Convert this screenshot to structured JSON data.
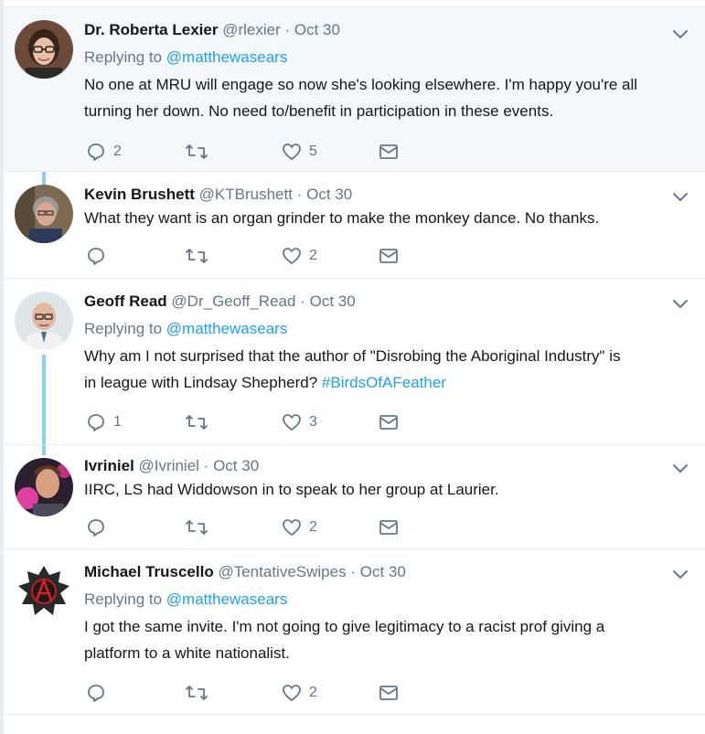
{
  "tweets": [
    {
      "name": "Dr. Roberta Lexier",
      "handle": "@rlexier",
      "separator": "·",
      "time": "Oct 30",
      "replying_prefix": "Replying to",
      "replying_to": "@matthewasears",
      "text_line1": "No one at MRU will engage so now she's looking elsewhere. I'm happy you're all",
      "text_line2": "turning her down. No need to/benefit in participation in these events.",
      "reply_count": "2",
      "retweet_count": "",
      "like_count": "5",
      "avatar_icon": "person-glasses-avatar"
    },
    {
      "name": "Kevin Brushett",
      "handle": "@KTBrushett",
      "separator": "·",
      "time": "Oct 30",
      "text_line1": "What they want is an organ grinder to make the monkey dance.   No thanks.",
      "reply_count": "",
      "retweet_count": "",
      "like_count": "2",
      "avatar_icon": "person-grey-hair-avatar"
    },
    {
      "name": "Geoff Read",
      "handle": "@Dr_Geoff_Read",
      "separator": "·",
      "time": "Oct 30",
      "replying_prefix": "Replying to",
      "replying_to": "@matthewasears",
      "text_line1": "Why am I not surprised that the author of \"Disrobing the Aboriginal Industry\" is",
      "text_line2_pre": "in league with Lindsay Shepherd? ",
      "hashtag": "#BirdsOfAFeather",
      "reply_count": "1",
      "retweet_count": "",
      "like_count": "3",
      "avatar_icon": "person-bald-glasses-avatar"
    },
    {
      "name": "Ivriniel",
      "handle": "@Ivriniel",
      "separator": "·",
      "time": "Oct 30",
      "text_line1": "IIRC, LS had Widdowson in to speak to her group at Laurier.",
      "reply_count": "",
      "retweet_count": "",
      "like_count": "2",
      "avatar_icon": "person-pink-avatar"
    },
    {
      "name": "Michael Truscello",
      "handle": "@TentativeSwipes",
      "separator": "·",
      "time": "Oct 30",
      "replying_prefix": "Replying to",
      "replying_to": "@matthewasears",
      "text_line1": "I got the same invite. I'm not going to give legitimacy to a racist prof giving a",
      "text_line2": "platform to a white nationalist.",
      "reply_count": "",
      "retweet_count": "",
      "like_count": "2",
      "avatar_icon": "anarchy-symbol-avatar"
    }
  ],
  "colors": {
    "link": "#1da1f2",
    "muted": "#657786",
    "thread_line": "#8ecff6",
    "highlight_bg": "#f5f8fa"
  }
}
